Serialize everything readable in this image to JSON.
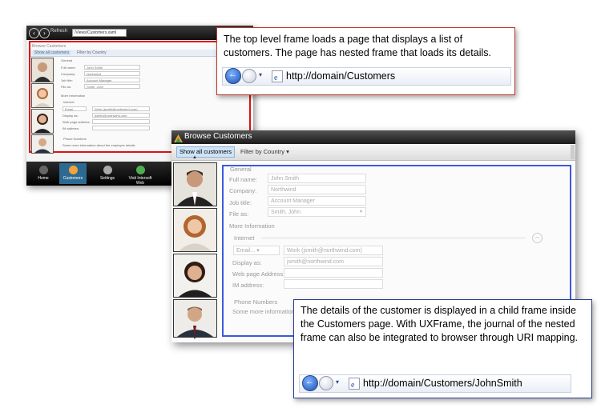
{
  "back_window": {
    "toolbar_refresh": "Refresh",
    "url": "/Views/Customers.xaml",
    "frame_title": "Browse Customers",
    "tabs": [
      "Show all customers",
      "Filter by Country"
    ],
    "section_general": "General",
    "fields": [
      {
        "label": "Full name:",
        "value": "John Smith"
      },
      {
        "label": "Company:",
        "value": "Northwind"
      },
      {
        "label": "Job title:",
        "value": "Account Manager"
      },
      {
        "label": "File as:",
        "value": "Smith, John"
      }
    ],
    "section_more": "More Information",
    "section_internet": "Internet",
    "email_label": "Email...",
    "email_value": "Work (jsmith@northwind.com)",
    "display_as_label": "Display as:",
    "display_as_value": "jsmith@northwind.com",
    "web_label": "Web page address:",
    "im_label": "IM address:",
    "phone_section": "Phone Numbers",
    "more_text": "Some more information about the employee details",
    "nav": [
      "Home",
      "Customers",
      "Settings",
      "Visit Intersoft Web"
    ]
  },
  "front_window": {
    "title": "Browse Customers",
    "tab_active": "Show all customers",
    "tab_filter": "Filter by Country",
    "section_general": "General",
    "fields": [
      {
        "label": "Full name:",
        "value": "John Smith"
      },
      {
        "label": "Company:",
        "value": "Northwind"
      },
      {
        "label": "Job title:",
        "value": "Account Manager"
      },
      {
        "label": "File as:",
        "value": "Smith, John"
      }
    ],
    "section_more": "More Information",
    "section_internet": "Internet",
    "email_label": "Email...",
    "email_value": "Work (jsmith@northwind.com)",
    "display_as_label": "Display as:",
    "display_as_value": "jsmith@northwind.com",
    "web_label": "Web page Address:",
    "im_label": "IM address:",
    "phone_section": "Phone Numbers",
    "more_text": "Some more information"
  },
  "callout_top": {
    "text": "The top level frame loads a page that displays a list of customers. The page has nested frame that loads its details.",
    "address": "http://domain/Customers"
  },
  "callout_bottom": {
    "text": "The details of the customer is displayed in a child frame inside the Customers page. With UXFrame,  the journal of  the nested frame can also be integrated to browser through URI mapping.",
    "address": "http://domain/Customers/JohnSmith"
  },
  "colors": {
    "red_frame": "#dd1111",
    "blue_frame": "#3b5bdb",
    "active_tab": "#cfe3f7"
  }
}
